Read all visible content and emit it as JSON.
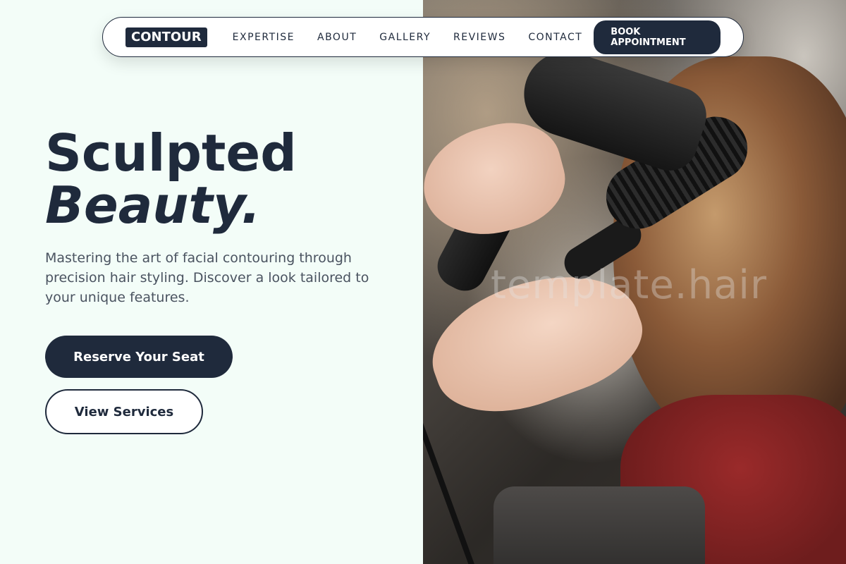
{
  "nav": {
    "logo": "CONTOUR",
    "links": [
      "EXPERTISE",
      "ABOUT",
      "GALLERY",
      "REVIEWS",
      "CONTACT"
    ],
    "cta": "BOOK APPOINTMENT"
  },
  "hero": {
    "title_line1": "Sculpted",
    "title_line2": "Beauty.",
    "subtitle": "Mastering the art of facial contouring through precision hair styling. Discover a look tailored to your unique features.",
    "primary_button": "Reserve Your Seat",
    "secondary_button": "View Services"
  },
  "image": {
    "watermark": "template.hair"
  },
  "colors": {
    "brand": "#1f2a3c",
    "background": "#f3fdf8"
  }
}
